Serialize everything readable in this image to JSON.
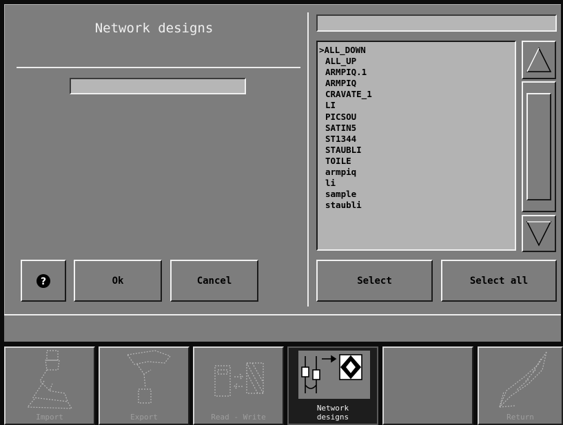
{
  "dialog": {
    "title": "Network designs",
    "name_field_value": "",
    "help_glyph": "?",
    "ok_label": "Ok",
    "cancel_label": "Cancel",
    "status_text": ""
  },
  "file_list": {
    "filter_value": "",
    "items": [
      ">ALL_DOWN",
      "ALL_UP",
      "ARMPIQ.1",
      "ARMPIQ",
      "CRAVATE_1",
      "LI",
      "PICSOU",
      "SATIN5",
      "ST1344",
      "STAUBLI",
      "TOILE",
      "armpiq",
      "li",
      "sample",
      "staubli"
    ],
    "select_label": "Select",
    "select_all_label": "Select all"
  },
  "toolbar": {
    "import_label": "Import",
    "export_label": "Export",
    "read_write_label": "Read - Write",
    "network_label": "Network designs",
    "return_label": "Return"
  },
  "icons": {
    "help": "question-circle-icon",
    "scroll_up": "triangle-up-icon",
    "scroll_down": "triangle-down-icon",
    "import": "import-hand-icon",
    "export": "export-hand-icon",
    "read_write": "read-write-icon",
    "network": "network-designs-icon",
    "return": "return-arrow-icon"
  },
  "colors": {
    "panel": "#7d7d7d",
    "field": "#b6b6b6",
    "highlight": "#f0f0f0",
    "background": "#0c0c0c"
  }
}
